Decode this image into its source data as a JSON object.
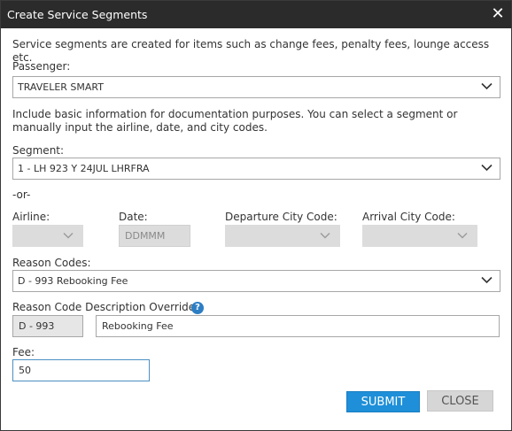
{
  "window": {
    "title": "Create Service Segments"
  },
  "intro": "Service segments are created for items such as change fees, penalty fees, lounge access etc.",
  "passenger": {
    "label": "Passenger:",
    "value": "TRAVELER SMART"
  },
  "info": "Include basic information for documentation purposes. You can select a segment or manually input the airline, date, and city codes.",
  "segment": {
    "label": "Segment:",
    "value": "1 - LH 923 Y 24JUL LHRFRA"
  },
  "or_text": "-or-",
  "airline": {
    "label": "Airline:",
    "value": ""
  },
  "date": {
    "label": "Date:",
    "placeholder": "DDMMM"
  },
  "departure": {
    "label": "Departure City Code:",
    "value": ""
  },
  "arrival": {
    "label": "Arrival City Code:",
    "value": ""
  },
  "reason": {
    "label": "Reason Codes:",
    "value": "D - 993 Rebooking Fee"
  },
  "override": {
    "label": "Reason Code Description Override:",
    "code": "D - 993",
    "description": "Rebooking Fee",
    "help_icon": "?"
  },
  "fee": {
    "label": "Fee:",
    "value": "50"
  },
  "buttons": {
    "submit": "SUBMIT",
    "close": "CLOSE"
  },
  "icons": {
    "close": "close-icon",
    "dropdown": "chevron-down-icon",
    "help": "help-icon"
  },
  "colors": {
    "titlebar": "#2b2b2b",
    "primary": "#1e8fd8",
    "secondary": "#d6d6d6",
    "help": "#2d7ec4",
    "focus_border": "#4d90c2"
  }
}
